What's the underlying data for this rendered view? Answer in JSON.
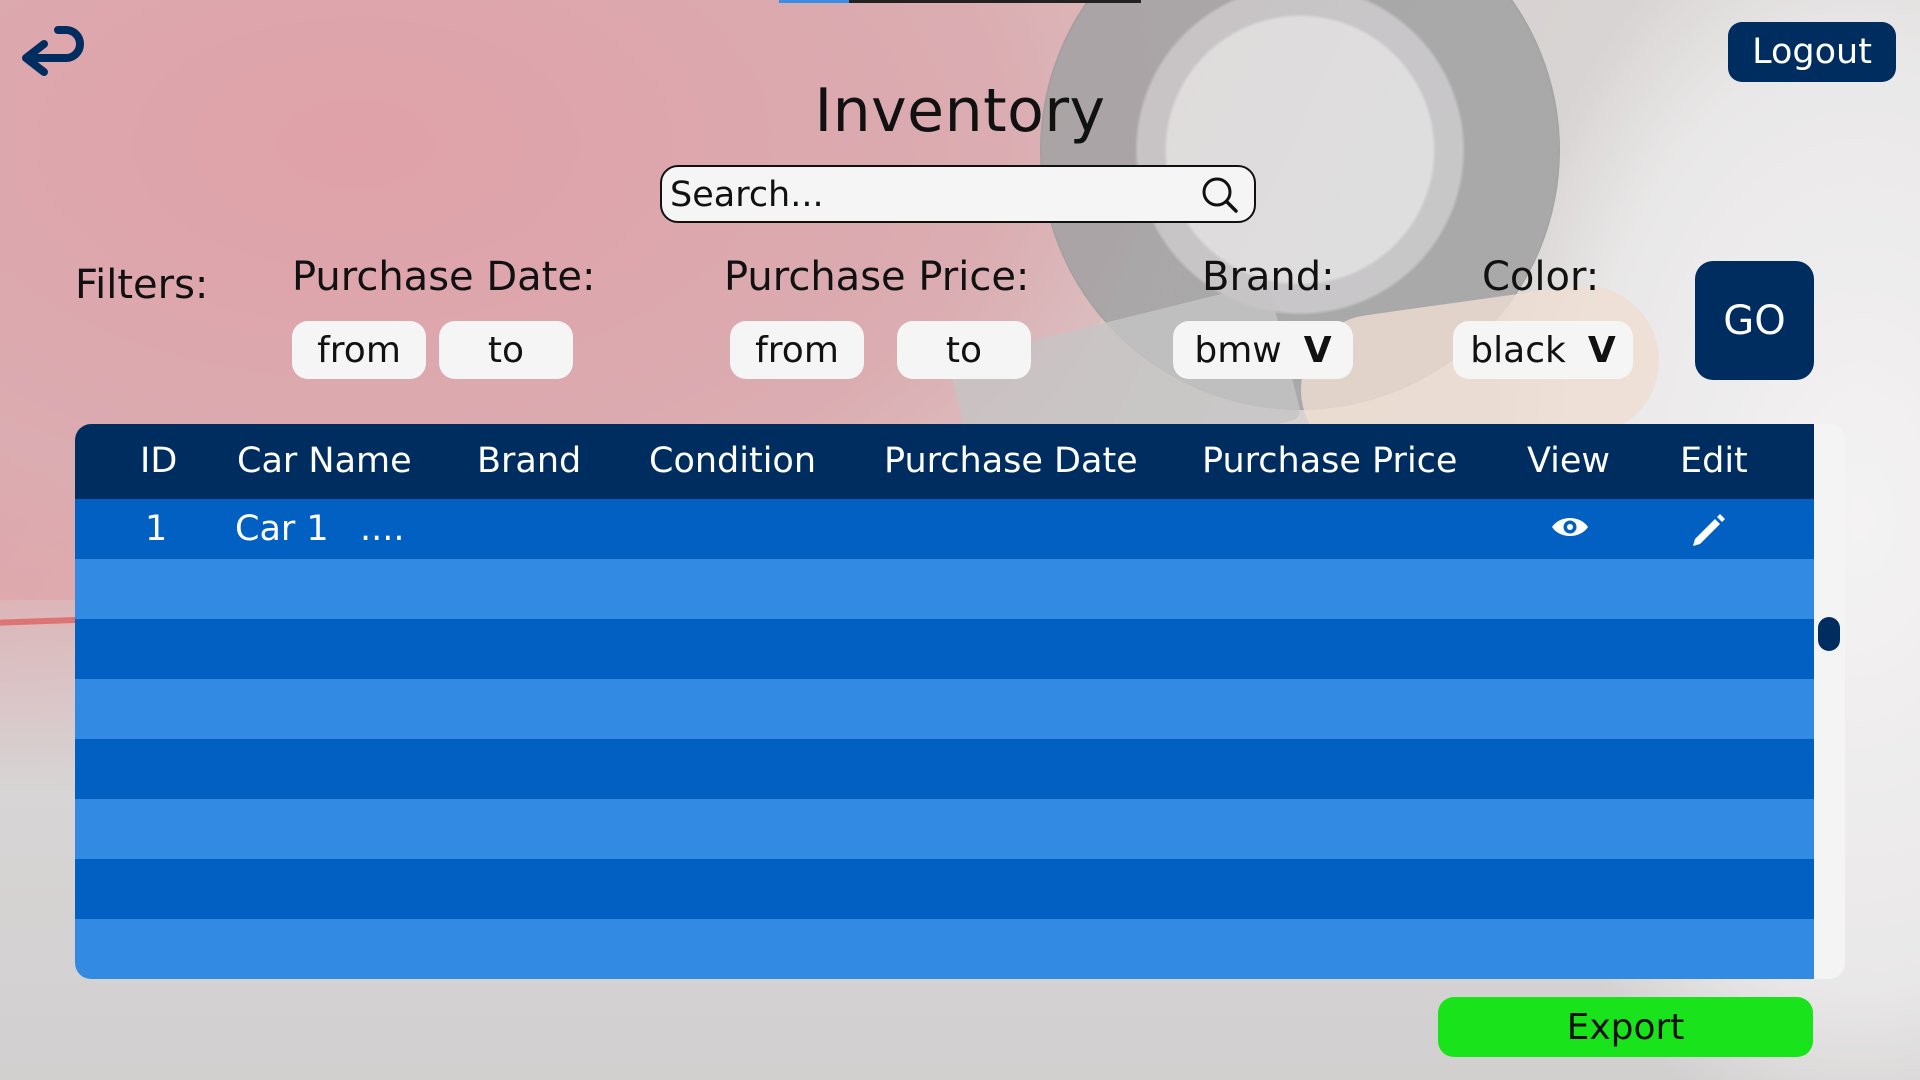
{
  "header": {
    "title": "Inventory",
    "logout_label": "Logout"
  },
  "search": {
    "placeholder": "Search..."
  },
  "filters": {
    "label": "Filters:",
    "purchase_date": {
      "label": "Purchase Date:",
      "from": "from",
      "to": "to"
    },
    "purchase_price": {
      "label": "Purchase Price:",
      "from": "from",
      "to": "to"
    },
    "brand": {
      "label": "Brand:",
      "value": "bmw",
      "chevron": "V"
    },
    "color": {
      "label": "Color:",
      "value": "black",
      "chevron": "V"
    },
    "go_label": "GO"
  },
  "table": {
    "columns": [
      "ID",
      "Car Name",
      "Brand",
      "Condition",
      "Purchase Date",
      "Purchase Price",
      "View",
      "Edit"
    ],
    "rows": [
      {
        "id": "1",
        "car_name": "Car 1",
        "brand": "....",
        "view_icon": "eye-icon",
        "edit_icon": "pencil-icon"
      }
    ],
    "empty_rows": 7
  },
  "export_label": "Export",
  "colors": {
    "navy": "#002d60",
    "row_dark": "#0260c2",
    "row_light": "#338ae3",
    "export_green": "#19e31b"
  }
}
